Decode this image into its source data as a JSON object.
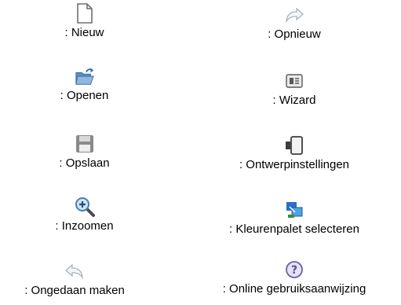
{
  "legend": {
    "left": [
      {
        "icon": "new-document-icon",
        "label": ": Nieuw"
      },
      {
        "icon": "open-folder-icon",
        "label": ": Openen"
      },
      {
        "icon": "save-icon",
        "label": ": Opslaan"
      },
      {
        "icon": "zoom-in-icon",
        "label": ": Inzoomen"
      },
      {
        "icon": "undo-icon",
        "label": ": Ongedaan maken"
      }
    ],
    "right": [
      {
        "icon": "redo-icon",
        "label": ": Opnieuw"
      },
      {
        "icon": "wizard-icon",
        "label": ": Wizard"
      },
      {
        "icon": "design-settings-icon",
        "label": ": Ontwerpinstellingen"
      },
      {
        "icon": "color-palette-icon",
        "label": ": Kleurenpalet selecteren"
      },
      {
        "icon": "online-help-icon",
        "label": ": Online gebruiksaanwijzing"
      }
    ]
  }
}
